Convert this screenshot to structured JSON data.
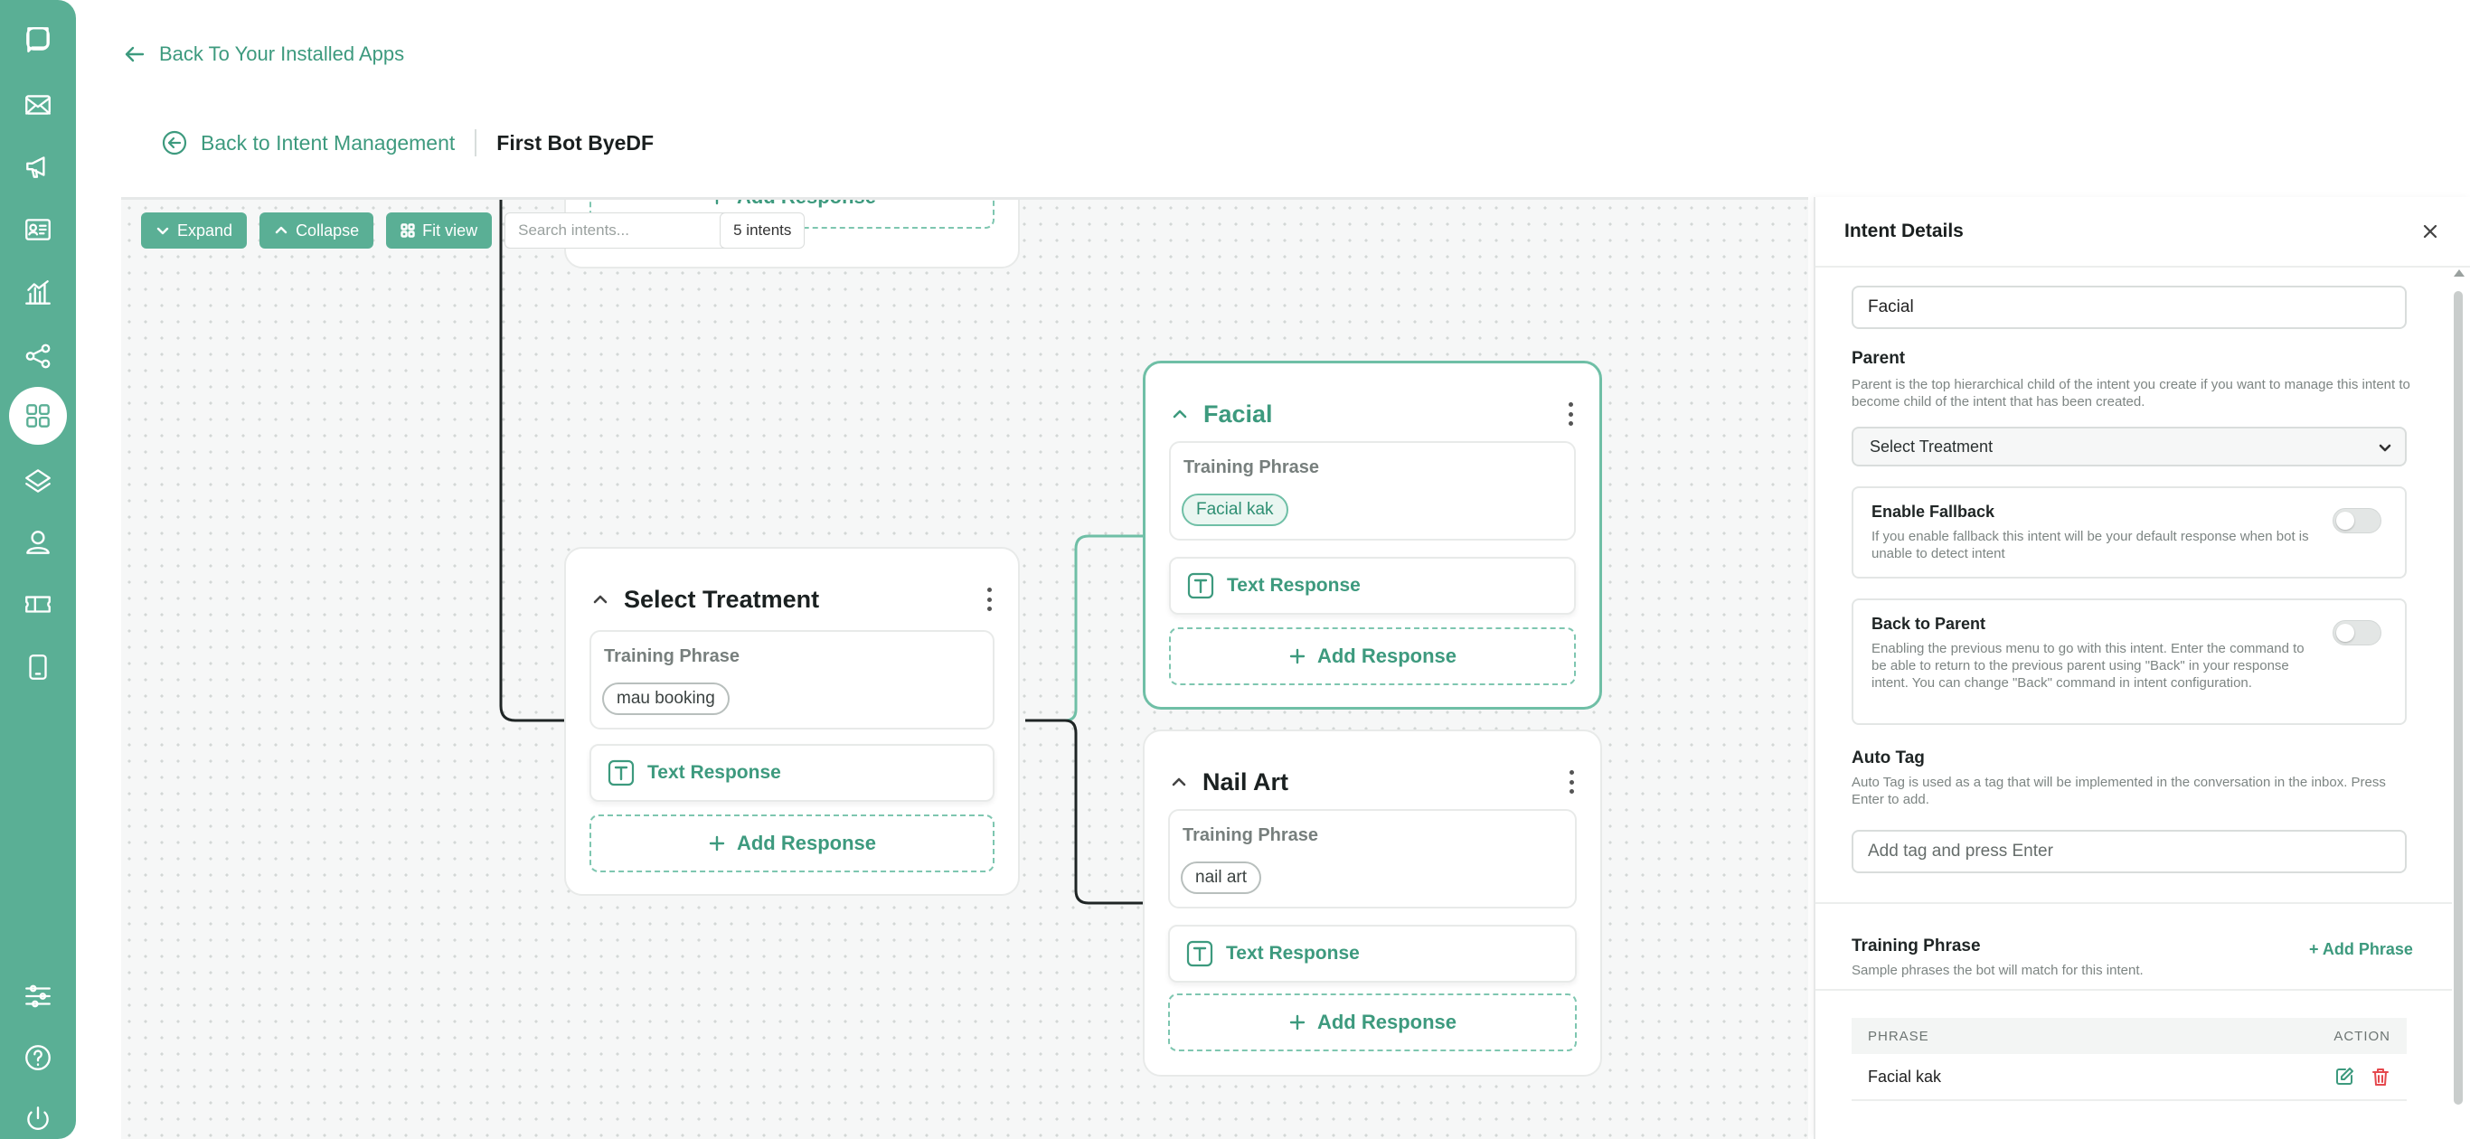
{
  "top": {
    "back_apps_label": "Back To Your Installed Apps",
    "back_intent_label": "Back to Intent Management",
    "bot_name": "First Bot ByeDF"
  },
  "toolbar": {
    "expand_label": "Expand",
    "collapse_label": "Collapse",
    "fit_view_label": "Fit view",
    "search_placeholder": "Search intents...",
    "intent_count": "5 intents"
  },
  "nodes": {
    "top_partial": {
      "add_response_label": "Add Response"
    },
    "select_treatment": {
      "title": "Select Treatment",
      "training_phrase_label": "Training Phrase",
      "phrase": "mau booking",
      "text_response_label": "Text Response",
      "add_response_label": "Add Response"
    },
    "facial": {
      "title": "Facial",
      "training_phrase_label": "Training Phrase",
      "phrase": "Facial kak",
      "text_response_label": "Text Response",
      "add_response_label": "Add Response"
    },
    "nail_art": {
      "title": "Nail Art",
      "training_phrase_label": "Training Phrase",
      "phrase": "nail art",
      "text_response_label": "Text Response",
      "add_response_label": "Add Response"
    }
  },
  "panel": {
    "title": "Intent Details",
    "intent_name_value": "Facial",
    "parent_label": "Parent",
    "parent_desc": "Parent is the top hierarchical child of the intent you create if you want to manage this intent to become child of the intent that has been created.",
    "parent_selected": "Select Treatment",
    "fallback_title": "Enable Fallback",
    "fallback_desc": "If you enable fallback this intent will be your default response when bot is unable to detect intent",
    "back_parent_title": "Back to Parent",
    "back_parent_desc": "Enabling the previous menu to go with this intent. Enter the command to be able to return to the previous parent using \"Back\" in your response intent. You can change \"Back\" command in intent configuration.",
    "auto_tag_label": "Auto Tag",
    "auto_tag_desc": "Auto Tag is used as a tag that will be implemented in the conversation in the inbox. Press Enter to add.",
    "auto_tag_placeholder": "Add tag and press Enter",
    "training_label": "Training Phrase",
    "training_desc": "Sample phrases the bot will match for this intent.",
    "add_phrase_label": "+ Add Phrase",
    "table": {
      "col_phrase": "PHRASE",
      "col_action": "ACTION",
      "rows": [
        {
          "phrase": "Facial kak"
        }
      ]
    }
  },
  "colors": {
    "brand": "#5aaf95",
    "accent_text": "#3d9a7e",
    "danger": "#e5484d"
  },
  "icons": {
    "sidebar": [
      "chat-bubble-icon",
      "mail-icon",
      "megaphone-icon",
      "contact-card-icon",
      "analytics-icon",
      "share-flow-icon",
      "apps-grid-icon",
      "layers-icon",
      "user-icon",
      "ticket-icon",
      "mobile-icon",
      "settings-sliders-icon",
      "help-icon",
      "power-icon"
    ]
  }
}
